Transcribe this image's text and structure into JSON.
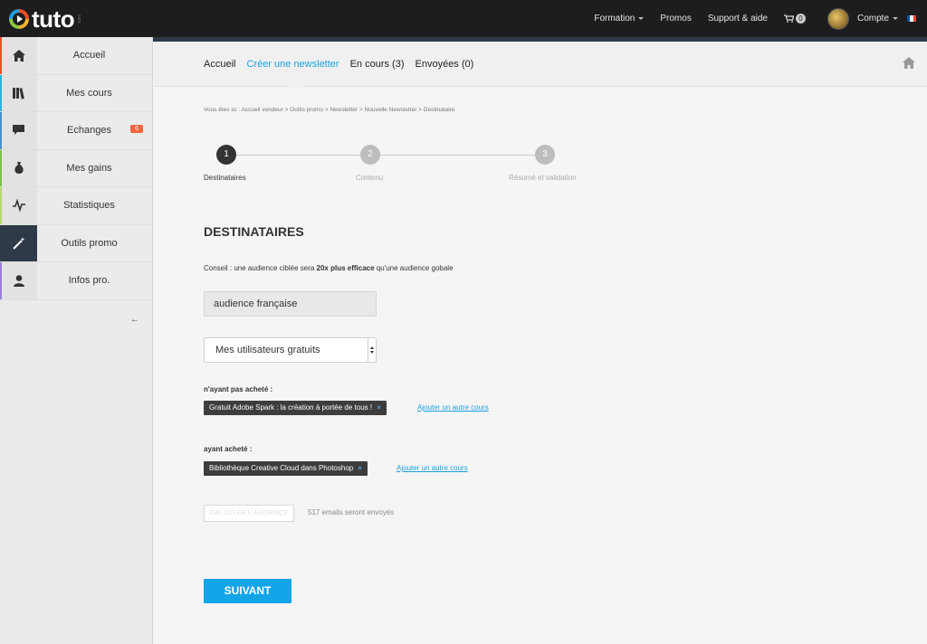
{
  "brand": {
    "logo_text": "tuto",
    "logo_sub": "com"
  },
  "topnav": {
    "formation": "Formation",
    "promos": "Promos",
    "support": "Support & aide",
    "cart_count": "0",
    "account": "Compte",
    "flag_colors": [
      "#0055a4",
      "#ffffff",
      "#ef4135"
    ]
  },
  "sidebar": {
    "items": [
      {
        "label": "Accueil",
        "icon": "home-icon",
        "accent": "#f04e23"
      },
      {
        "label": "Mes cours",
        "icon": "books-icon",
        "accent": "#2bb5d8"
      },
      {
        "label": "Echanges",
        "icon": "chat-icon",
        "accent": "#4a90c8",
        "badge": "6"
      },
      {
        "label": "Mes gains",
        "icon": "money-bag-icon",
        "accent": "#7cc24a"
      },
      {
        "label": "Statistiques",
        "icon": "pulse-icon",
        "accent": "#b5d86a"
      },
      {
        "label": "Outils promo",
        "icon": "magic-wand-icon",
        "accent": "#2e3a47"
      },
      {
        "label": "Infos pro.",
        "icon": "user-icon",
        "accent": "#9b7fd4"
      }
    ],
    "collapse": "←"
  },
  "subnav": {
    "tabs": [
      {
        "label": "Accueil"
      },
      {
        "label": "Créer une newsletter"
      },
      {
        "label": "En cours (3)"
      },
      {
        "label": "Envoyées (0)"
      }
    ]
  },
  "breadcrumb": "Vous êtes ici : Accueil vendeur > Outils promo > Newsletter > Nouvelle Newsletter > Destinataire",
  "steps": [
    {
      "num": "1",
      "label": "Destinataires"
    },
    {
      "num": "2",
      "label": "Contenu"
    },
    {
      "num": "3",
      "label": "Résumé et validation"
    }
  ],
  "section_title": "DESTINATAIRES",
  "tip": {
    "prefix": "Conseil : une audience ciblée sera ",
    "bold": "20x plus efficace",
    "suffix": " qu'une audience gobale"
  },
  "audience_name": "audience française",
  "users_select": "Mes utilisateurs gratuits",
  "not_bought": {
    "label": "n'ayant pas acheté :",
    "chip": "Gratuit Adobe Spark : la création à portée de tous !",
    "add_link": "Ajouter un autre cours"
  },
  "bought": {
    "label": "ayant acheté :",
    "chip": "Bibliothèque Creative Cloud dans Photoshop",
    "add_link": "Ajouter un autre cours"
  },
  "chip_remove": "×",
  "calc_button": "CALCULER L'AUDIENCE",
  "email_count": "517 emails seront envoyés",
  "next_button": "SUIVANT",
  "colors": {
    "accent_blue": "#1ba1e2",
    "button_blue": "#12a5e8",
    "dark": "#2e3a47"
  }
}
